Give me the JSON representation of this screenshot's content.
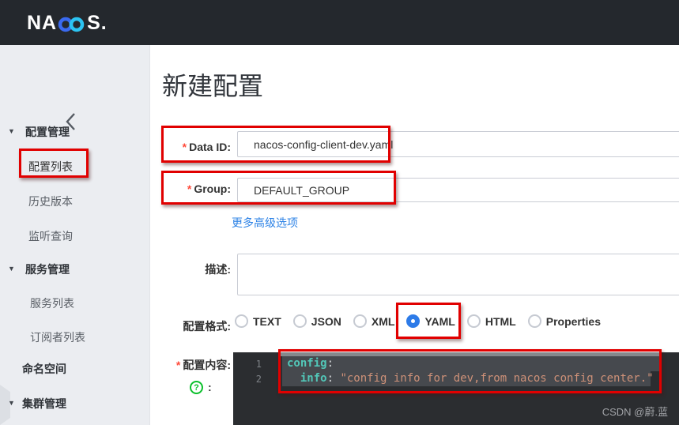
{
  "header": {
    "logo_prefix": "NA",
    "logo_suffix": "S."
  },
  "sidebar": {
    "items": [
      {
        "label": "配置管理",
        "type": "group",
        "expanded": true
      },
      {
        "label": "配置列表",
        "type": "sub",
        "annotated": true
      },
      {
        "label": "历史版本",
        "type": "sub"
      },
      {
        "label": "监听查询",
        "type": "sub"
      },
      {
        "label": "服务管理",
        "type": "group",
        "expanded": true
      },
      {
        "label": "服务列表",
        "type": "sub"
      },
      {
        "label": "订阅者列表",
        "type": "sub"
      },
      {
        "label": "命名空间",
        "type": "top"
      },
      {
        "label": "集群管理",
        "type": "group",
        "expanded": true
      }
    ]
  },
  "main": {
    "title": "新建配置",
    "form": {
      "data_id": {
        "label": "Data ID:",
        "required": "*",
        "value": "nacos-config-client-dev.yaml"
      },
      "group": {
        "label": "Group:",
        "required": "*",
        "value": "DEFAULT_GROUP"
      },
      "more_options_link": "更多高级选项",
      "description": {
        "label": "描述:",
        "value": ""
      },
      "format": {
        "label": "配置格式:",
        "options": [
          "TEXT",
          "JSON",
          "XML",
          "YAML",
          "HTML",
          "Properties"
        ],
        "selected": "YAML"
      },
      "content": {
        "label": "配置内容:",
        "required": "*",
        "help": "?",
        "colon": ":"
      }
    },
    "editor": {
      "language": "yaml",
      "lines": [
        {
          "number": "1",
          "key": "config",
          "punct": ":",
          "string": ""
        },
        {
          "number": "2",
          "indent": "  ",
          "key": "info",
          "punct": ": ",
          "string": "\"config info for dev,from nacos config center.\""
        }
      ]
    }
  },
  "watermark": "CSDN @蔚.蓝",
  "colors": {
    "header_bg": "#24282d",
    "sidebar_bg": "#ebedf1",
    "accent_blue": "#2d7be8",
    "link_blue": "#2e83e6",
    "annotation_red": "#e10000",
    "editor_bg": "#2b2d30",
    "editor_key": "#52c7b8",
    "editor_string": "#ce9178",
    "help_green": "#0cc02c"
  }
}
